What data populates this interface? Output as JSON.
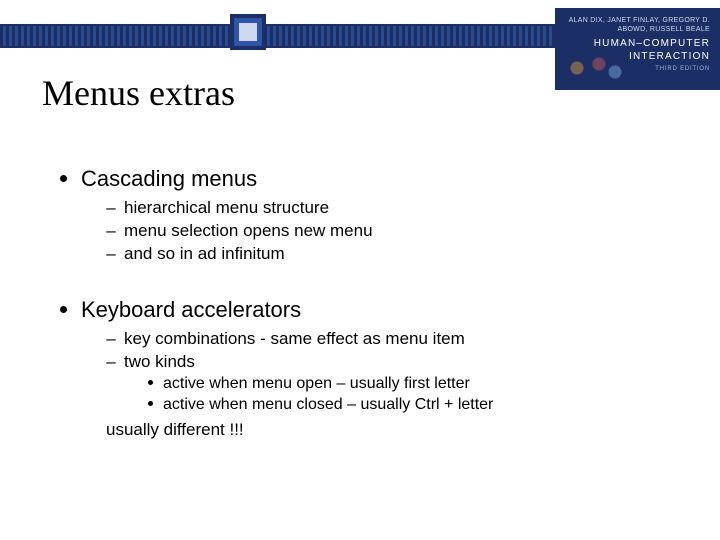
{
  "header": {
    "authors": "ALAN DIX, JANET FINLAY, GREGORY D. ABOWD, RUSSELL BEALE",
    "book_title": "HUMAN–COMPUTER INTERACTION",
    "edition": "THIRD EDITION"
  },
  "title": "Menus extras",
  "bullets": {
    "b1a": "Cascading menus",
    "b1a_subs": {
      "s1": "hierarchical menu structure",
      "s2": "menu selection opens new menu",
      "s3": "and so in ad infinitum"
    },
    "b1b": "Keyboard accelerators",
    "b1b_subs": {
      "s1": "key combinations - same effect as menu item",
      "s2": "two kinds",
      "s2_subs": {
        "t1": "active when menu open – usually first letter",
        "t2": "active when menu closed – usually Ctrl + letter"
      },
      "note": "usually different !!!"
    }
  }
}
